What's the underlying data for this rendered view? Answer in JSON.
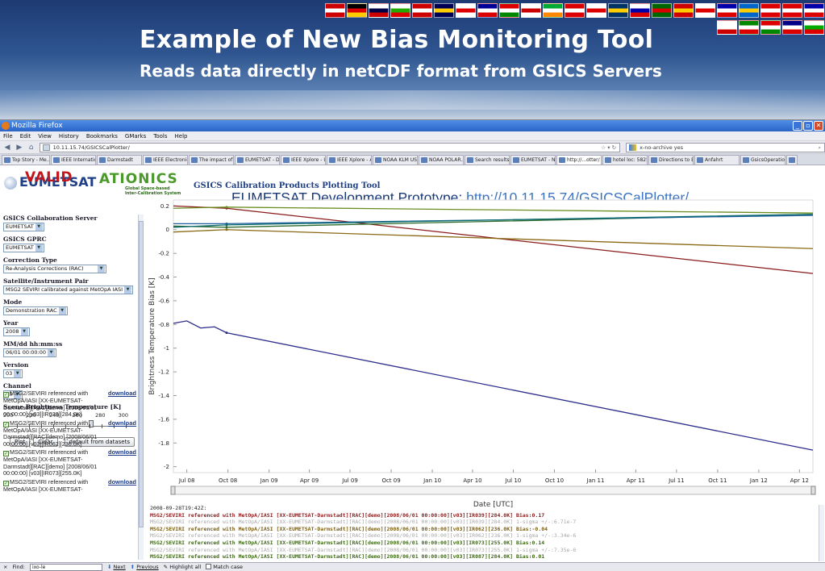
{
  "slide": {
    "title": "Example of New Bias Monitoring Tool",
    "subtitle": "Reads data directly in netCDF format from GSICS Servers"
  },
  "browser": {
    "window_title": "Mozilla Firefox",
    "menu": [
      "File",
      "Edit",
      "View",
      "History",
      "Bookmarks",
      "GMarks",
      "Tools",
      "Help"
    ],
    "url": "10.11.15.74/GSICSCalPlotter/",
    "search_text": "x-no-archive yes",
    "tabs": [
      "Top Story - Me...",
      "IEEE Internatio...",
      "Darmstadt",
      "IEEE Electronic...",
      "The impact of ...",
      "EUMETSAT - D...",
      "IEEE Xplore - U...",
      "IEEE Xplore - A...",
      "NOAA KLM USE...",
      "NOAA POLAR...",
      "Search results",
      "EUMETSAT - N...",
      "http://...otter/",
      "hotel loc: 5825",
      "Directions to E...",
      "Anfahrt",
      "GsicsOperation..."
    ],
    "active_tab_index": 12
  },
  "page": {
    "logo_eumetsat": "EUMETSAT",
    "logo_valid": "VALID",
    "logo_gsics": "ATIONICS",
    "logo_gsics_tag": "Global Space-based\nInter-Calibration System",
    "tool_title": "GSICS Calibration Products Plotting Tool",
    "prototype_label": "EUMETSAT Development Prototype:",
    "prototype_url": "http://10.11.15.74/GSICSCalPlotter/"
  },
  "controls": {
    "server_label": "GSICS Collaboration Server",
    "server_value": "EUMETSAT",
    "gprc_label": "GSICS GPRC",
    "gprc_value": "EUMETSAT",
    "correction_label": "Correction Type",
    "correction_value": "Re-Analysis Corrections (RAC)",
    "pair_label": "Satellite/Instrument Pair",
    "pair_value": "MSG2 SEVIRI calibrated against MetOpA IASI",
    "mode_label": "Mode",
    "mode_value": "Demonstration RAC",
    "year_label": "Year",
    "year_value": "2008",
    "date_label": "MM/dd hh:mm:ss",
    "date_value": "06/01 00:00:00",
    "version_label": "Version",
    "version_value": "03",
    "channel_label": "Channel",
    "channel_value": "All",
    "tb_label": "Scene Brightness Temperature [K]",
    "tb_ticks": [
      "200",
      "220",
      "240",
      "260",
      "280",
      "300"
    ],
    "tb_value": 271,
    "btn_plot": "Plot",
    "btn_clear": "Clear",
    "btn_default": "default from datasets"
  },
  "datasets": [
    {
      "text": "MSG2/SEVIRI referenced with MetOpA/IASI [XX-EUMETSAT-Darmstadt][RAC][demo] [2008/06/01 00:00:00] [v03][IR039][284.0K]",
      "link": "download"
    },
    {
      "text": "MSG2/SEVIRI referenced with MetOpA/IASI [XX-EUMETSAT-Darmstadt][RAC][demo] [2008/06/01 00:00:00] [v03][IR062][236.0K]",
      "link": "download"
    },
    {
      "text": "MSG2/SEVIRI referenced with MetOpA/IASI [XX-EUMETSAT-Darmstadt][RAC][demo] [2008/06/01 00:00:00] [v03][IR073][255.0K]",
      "link": "download"
    },
    {
      "text": "MSG2/SEVIRI referenced with MetOpA/IASI [XX-EUMETSAT-",
      "link": "download"
    }
  ],
  "chart_data": {
    "type": "line",
    "xlabel": "Date [UTC]",
    "ylabel": "Brightness Temperature Bias [K]",
    "x_ticks": [
      "Jul 08",
      "Oct 08",
      "Jan 09",
      "Apr 09",
      "Jul 09",
      "Oct 09",
      "Jan 10",
      "Apr 10",
      "Jul 10",
      "Oct 10",
      "Jan 11",
      "Apr 11",
      "Jul 11",
      "Oct 11",
      "Jan 12",
      "Apr 12"
    ],
    "y_ticks": [
      "0.2",
      "0",
      "-0.2",
      "-0.4",
      "-0.6",
      "-0.8",
      "-1",
      "-1.2",
      "-1.4",
      "-1.6",
      "-1.8",
      "-2"
    ],
    "ylim": [
      -2.05,
      0.25
    ],
    "xlim": [
      "2008-06-01",
      "2012-05-01"
    ],
    "series": [
      {
        "color": "#8b1a1a",
        "x": [
          "2008-06-01",
          "2008-09-28",
          "2012-05-01"
        ],
        "y": [
          0.2,
          0.18,
          -0.37
        ]
      },
      {
        "color": "#2c2c8c",
        "x": [
          "2008-06-01",
          "2008-07-01",
          "2008-08-01",
          "2008-09-01",
          "2008-09-28",
          "2012-05-01"
        ],
        "y": [
          -0.79,
          -0.77,
          -0.83,
          -0.82,
          -0.87,
          -1.86
        ]
      },
      {
        "color": "#8b6914",
        "x": [
          "2008-06-01",
          "2008-09-28",
          "2012-05-01"
        ],
        "y": [
          -0.02,
          0.0,
          -0.16
        ]
      },
      {
        "color": "#2e6b2e",
        "x": [
          "2008-06-01",
          "2008-09-28",
          "2012-05-01"
        ],
        "y": [
          0.03,
          0.02,
          0.13
        ]
      },
      {
        "color": "#6b8e23",
        "x": [
          "2008-06-01",
          "2008-09-28",
          "2012-05-01"
        ],
        "y": [
          0.18,
          0.19,
          0.14
        ]
      },
      {
        "color": "#1f5f9f",
        "x": [
          "2008-06-01",
          "2008-09-28",
          "2012-05-01"
        ],
        "y": [
          0.05,
          0.05,
          0.12
        ]
      },
      {
        "color": "#0e6e6e",
        "x": [
          "2008-06-01",
          "2008-09-28",
          "2012-05-01"
        ],
        "y": [
          0.02,
          0.04,
          0.13
        ]
      }
    ]
  },
  "log": {
    "timestamp": "2008-09-28T19:42Z:",
    "lines": [
      {
        "style": "bold-red",
        "text": "MSG2/SEVIRI referenced with MetOpA/IASI [XX-EUMETSAT-Darmstadt][RAC][demo][2008/06/01 00:00:00][v03][IR039][284.0K] Bias:0.17"
      },
      {
        "style": "grey",
        "text": "MSG2/SEVIRI referenced with MetOpA/IASI [XX-EUMETSAT-Darmstadt][RAC][demo][2008/06/01 00:00:00][v03][IR039][284.0K] 1-sigma +/-:6.71e-7"
      },
      {
        "style": "bold-olive",
        "text": "MSG2/SEVIRI referenced with MetOpA/IASI [XX-EUMETSAT-Darmstadt][RAC][demo][2008/06/01 00:00:00][v03][IR062][236.0K] Bias:-0.04"
      },
      {
        "style": "grey",
        "text": "MSG2/SEVIRI referenced with MetOpA/IASI [XX-EUMETSAT-Darmstadt][RAC][demo][2008/06/01 00:00:00][v03][IR062][236.0K] 1-sigma +/-:3.34e-6"
      },
      {
        "style": "bold-green",
        "text": "MSG2/SEVIRI referenced with MetOpA/IASI [XX-EUMETSAT-Darmstadt][RAC][demo][2008/06/01 00:00:00][v03][IR073][255.0K] Bias:0.14"
      },
      {
        "style": "grey",
        "text": "MSG2/SEVIRI referenced with MetOpA/IASI [XX-EUMETSAT-Darmstadt][RAC][demo][2008/06/01 00:00:00][v03][IR073][255.0K] 1-sigma +/-:7.35e-6"
      },
      {
        "style": "bold-green",
        "text": "MSG2/SEVIRI referenced with MetOpA/IASI [XX-EUMETSAT-Darmstadt][RAC][demo][2008/06/01 00:00:00][v03][IR087][284.0K] Bias:0.01"
      },
      {
        "style": "grey",
        "text": "MSG2/SEVIRI referenced with MetOpA/IASI [XX-EUMETSAT-Darmstadt][RAC][demo][2008/06/01 00:00:00][v03][IR087][284.0K] 1-sigma +/-:1.47e-5"
      }
    ]
  },
  "findbar": {
    "find_label": "Find:",
    "find_value": "ixo-le",
    "next": "Next",
    "previous": "Previous",
    "highlight": "Highlight all",
    "match_case": "Match case"
  },
  "colors": {
    "accent": "#1f3f86",
    "banner": "#2f5590"
  }
}
